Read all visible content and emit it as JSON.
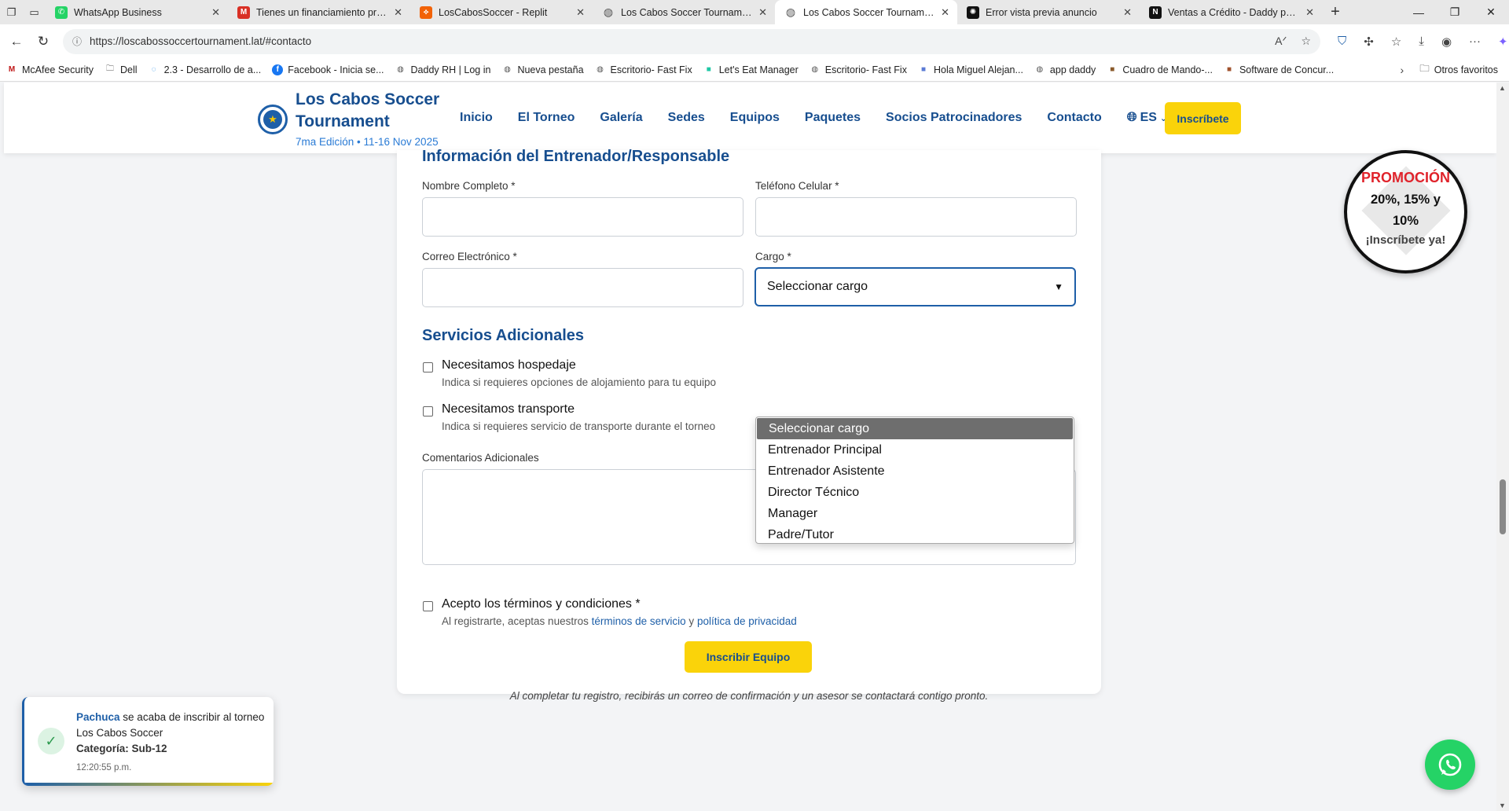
{
  "browser": {
    "tabs": [
      {
        "title": "WhatsApp Business",
        "icon": "whatsapp-icon",
        "color": "#25d366",
        "active": false
      },
      {
        "title": "Tienes un financiamiento pre-ap",
        "icon": "gmail-icon",
        "color": "#d93025",
        "active": false
      },
      {
        "title": "LosCabosSoccer - Replit",
        "icon": "replit-icon",
        "color": "#f26207",
        "active": false
      },
      {
        "title": "Los Cabos Soccer Tournament -",
        "icon": "globe-icon",
        "color": "#555555",
        "active": false
      },
      {
        "title": "Los Cabos Soccer Tournament -",
        "icon": "globe-icon",
        "color": "#555555",
        "active": true
      },
      {
        "title": "Error vista previa anuncio",
        "icon": "openai-icon",
        "color": "#111111",
        "active": false
      },
      {
        "title": "Ventas a Crédito - Daddy pollo",
        "icon": "notion-icon",
        "color": "#111111",
        "active": false
      }
    ],
    "url": "https://loscabossoccertournament.lat/#contacto",
    "bookmarks": [
      {
        "label": "McAfee Security",
        "icon": "mcafee-icon",
        "color": "#c01818"
      },
      {
        "label": "Dell",
        "icon": "folder-icon",
        "color": "#555555"
      },
      {
        "label": "2.3 - Desarrollo de a...",
        "icon": "loading-icon",
        "color": "#1e88e5"
      },
      {
        "label": "Facebook - Inicia se...",
        "icon": "facebook-icon",
        "color": "#1877f2"
      },
      {
        "label": "Daddy RH | Log in",
        "icon": "globe-icon",
        "color": "#555555"
      },
      {
        "label": "Nueva pestaña",
        "icon": "globe-icon",
        "color": "#555555"
      },
      {
        "label": "Escritorio- Fast Fix",
        "icon": "globe-icon",
        "color": "#555555"
      },
      {
        "label": "Let's Eat Manager",
        "icon": "app-icon",
        "color": "#1ec8a5"
      },
      {
        "label": "Escritorio- Fast Fix",
        "icon": "globe-icon",
        "color": "#555555"
      },
      {
        "label": "Hola Miguel Alejan...",
        "icon": "app-icon",
        "color": "#5b7bd5"
      },
      {
        "label": "app daddy",
        "icon": "globe-icon",
        "color": "#555555"
      },
      {
        "label": "Cuadro de Mando-...",
        "icon": "app-icon",
        "color": "#8a5a2b"
      },
      {
        "label": "Software de Concur...",
        "icon": "app-icon",
        "color": "#a0522d"
      }
    ],
    "other_bookmarks": "Otros favoritos"
  },
  "header": {
    "brand_name": "Los Cabos Soccer Tournament",
    "brand_sub": "7ma Edición • 11-16 Nov 2025",
    "nav": [
      "Inicio",
      "El Torneo",
      "Galería",
      "Sedes",
      "Equipos",
      "Paquetes",
      "Socios Patrocinadores",
      "Contacto"
    ],
    "lang": "ES",
    "cta": "Inscríbete"
  },
  "form": {
    "coach_title": "Información del Entrenador/Responsable",
    "full_name_label": "Nombre Completo *",
    "phone_label": "Teléfono Celular *",
    "email_label": "Correo Electrónico *",
    "role_label": "Cargo *",
    "role_value": "Seleccionar cargo",
    "role_options": [
      "Seleccionar cargo",
      "Entrenador Principal",
      "Entrenador Asistente",
      "Director Técnico",
      "Manager",
      "Padre/Tutor"
    ],
    "services_title": "Servicios Adicionales",
    "lodging_title": "Necesitamos hospedaje",
    "lodging_desc": "Indica si requieres opciones de alojamiento para tu equipo",
    "transport_title": "Necesitamos transporte",
    "transport_desc": "Indica si requieres servicio de transporte durante el torneo",
    "comments_label": "Comentarios Adicionales",
    "terms_title": "Acepto los términos y condiciones *",
    "terms_prefix": "Al registrarte, aceptas nuestros",
    "terms_link": "términos de servicio",
    "terms_and": "y",
    "privacy_link": "política de privacidad",
    "submit": "Inscribir Equipo",
    "confirmation": "Al completar tu registro, recibirás un correo de confirmación y un asesor se contactará contigo pronto."
  },
  "promo": {
    "title": "PROMOCIÓN",
    "discounts": "20%, 15% y 10%",
    "cta": "¡Inscríbete ya!"
  },
  "toast": {
    "team": "Pachuca",
    "message": "se acaba de inscribir al torneo Los Cabos Soccer",
    "category": "Categoría: Sub-12",
    "time": "12:20:55 p.m."
  },
  "colors": {
    "primary": "#174e8f",
    "accent": "#fad30a",
    "promo_red": "#e0232b",
    "whatsapp": "#25d366"
  }
}
